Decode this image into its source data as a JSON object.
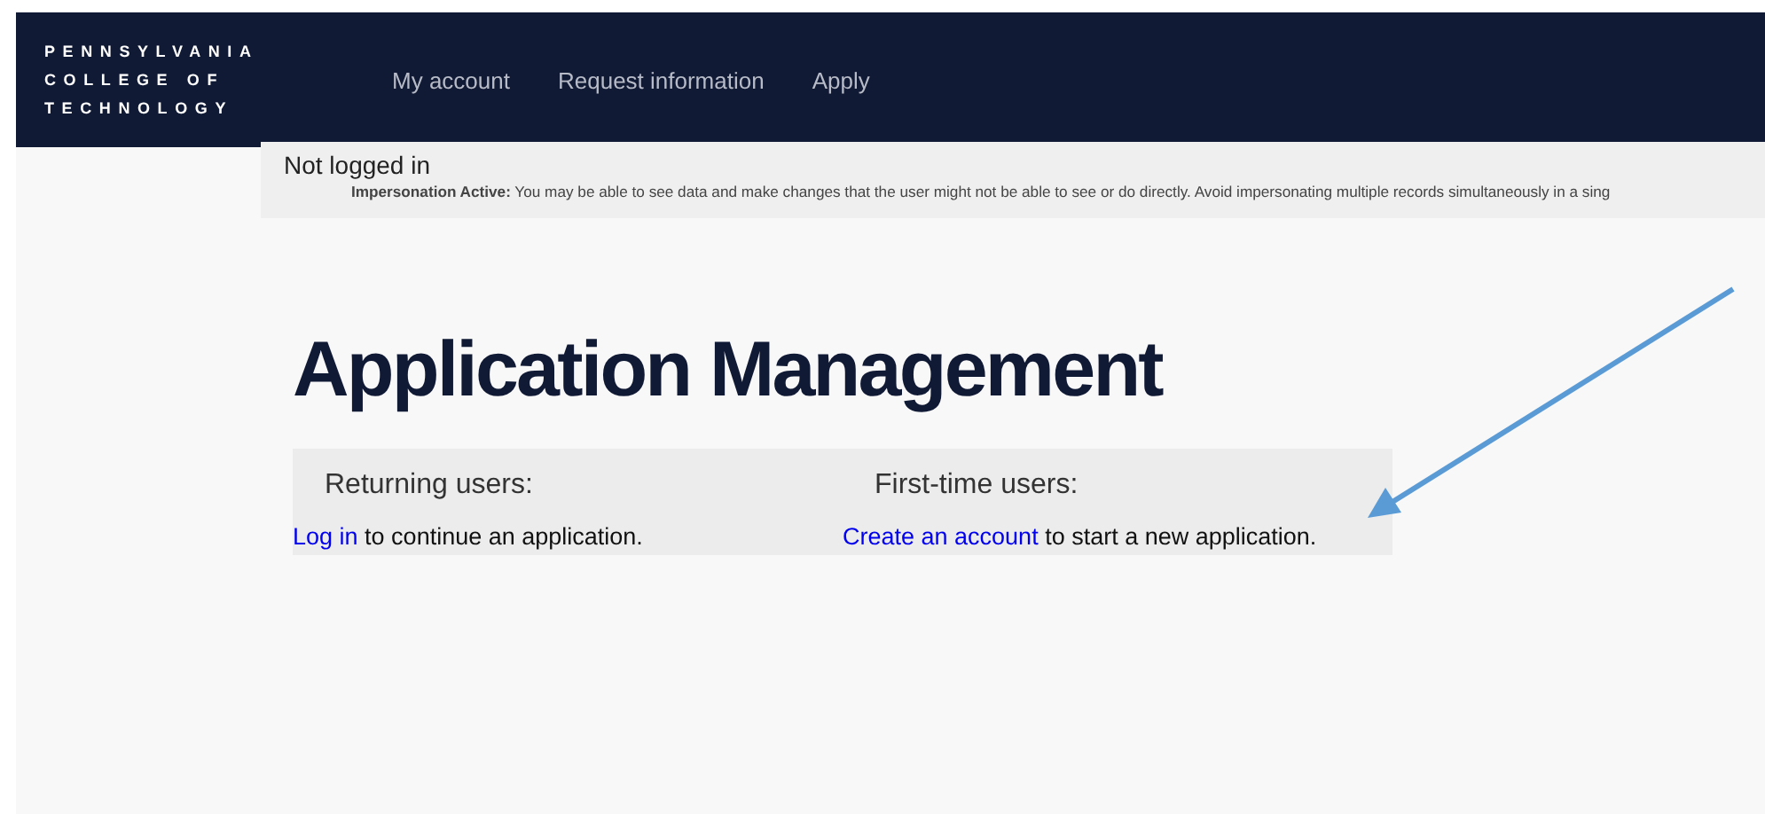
{
  "header": {
    "logo_lines": [
      "PENNSYLVANIA",
      "COLLEGE OF",
      "TECHNOLOGY"
    ],
    "nav": [
      {
        "label": "My account"
      },
      {
        "label": "Request information"
      },
      {
        "label": "Apply"
      }
    ]
  },
  "status_banner": {
    "title": "Not logged in",
    "notice_label": "Impersonation Active:",
    "notice": "You may be able to see data and make changes that the user might not be able to see or do directly. Avoid impersonating multiple records simultaneously in a sing"
  },
  "heading": "Application Management",
  "options": [
    {
      "title": "Returning users:",
      "link": "Log in",
      "text": "to continue an application."
    },
    {
      "title": "First-time users:",
      "link": "Create an account",
      "text": "to start a new application."
    }
  ]
}
